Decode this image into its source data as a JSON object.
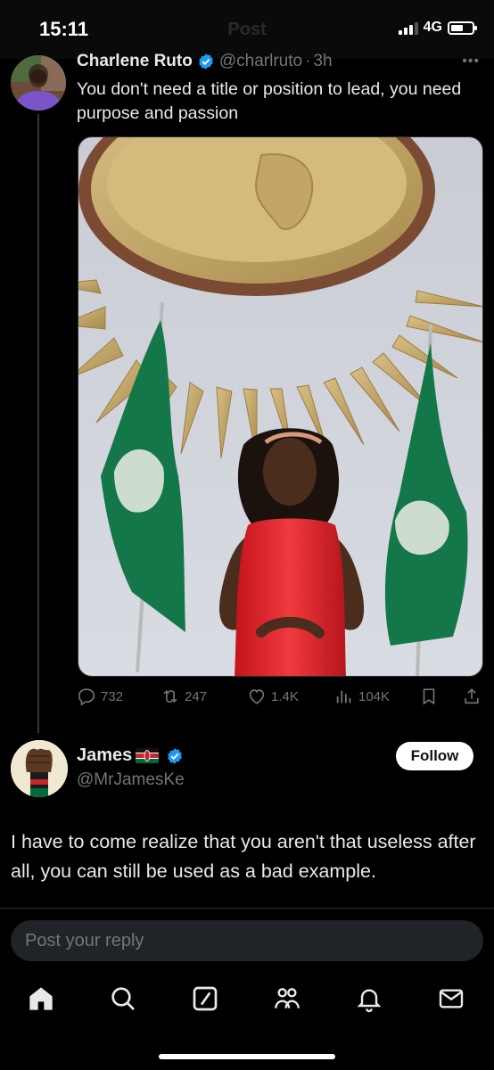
{
  "status_bar": {
    "time": "15:11",
    "network": "4G",
    "battery_level": 0.6
  },
  "header": {
    "title": "Post"
  },
  "original_post": {
    "author_name": "Charlene Ruto",
    "author_handle": "@charlruto",
    "separator": "·",
    "time_ago": "3h",
    "text": "You don't need a title or position to lead, you need purpose and passion",
    "image_icon": "photo-of-woman-in-red-dress-at-african-union",
    "stats": {
      "replies": "732",
      "reposts": "247",
      "likes": "1.4K",
      "views": "104K"
    }
  },
  "reply": {
    "author_name": "James",
    "author_handle": "@MrJamesKe",
    "follow_label": "Follow",
    "text": "I have to come realize that you aren't that useless after all, you can still be used as a bad example."
  },
  "composer": {
    "placeholder": "Post your reply"
  },
  "colors": {
    "background": "#000000",
    "text": "#e7e9ea",
    "muted": "#71767b",
    "verified": "#1d9bf0",
    "input_bg": "#202327"
  }
}
